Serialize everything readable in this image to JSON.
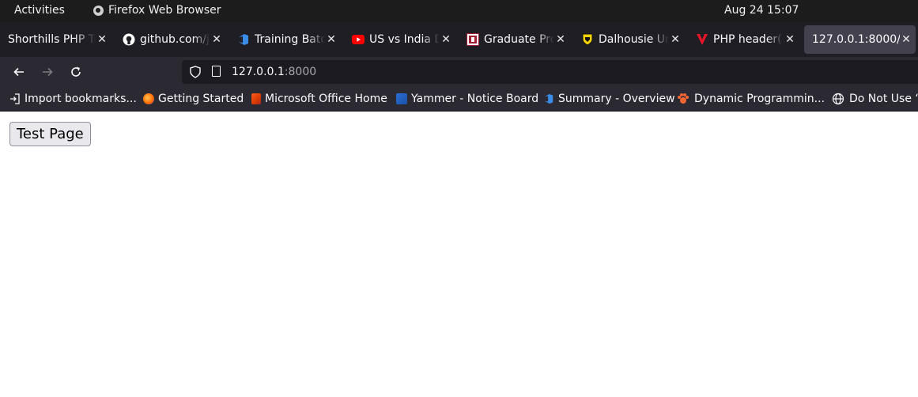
{
  "system_bar": {
    "activities": "Activities",
    "app_name": "Firefox Web Browser",
    "clock": "Aug 24  15:07"
  },
  "tabs": [
    {
      "title": "Shorthills PHP Tr",
      "icon": "shorthills-favicon-icon",
      "active": false
    },
    {
      "title": "github.com/j",
      "icon": "github-icon",
      "active": false
    },
    {
      "title": "Training Batc",
      "icon": "azure-devops-icon",
      "active": false
    },
    {
      "title": "US vs India Da",
      "icon": "youtube-icon",
      "active": false
    },
    {
      "title": "Graduate Pro",
      "icon": "university-crest-icon",
      "active": false
    },
    {
      "title": "Dalhousie Un",
      "icon": "dalhousie-shield-icon",
      "active": false
    },
    {
      "title": "PHP header()",
      "icon": "php-v-icon",
      "active": false
    },
    {
      "title": "127.0.0.1:8000/",
      "icon": "",
      "active": true
    }
  ],
  "navigation": {
    "url_host": "127.0.0.1",
    "url_port": ":8000"
  },
  "bookmarks": [
    {
      "label": "Import bookmarks...",
      "icon": "import-icon"
    },
    {
      "label": "Getting Started",
      "icon": "firefox-icon"
    },
    {
      "label": "Microsoft Office Home",
      "icon": "office-icon"
    },
    {
      "label": "Yammer - Notice Board",
      "icon": "yammer-icon"
    },
    {
      "label": "Summary - Overview",
      "icon": "azure-devops-icon"
    },
    {
      "label": "Dynamic Programmin...",
      "icon": "paw-icon"
    },
    {
      "label": "Do Not Use “",
      "icon": "globe-icon"
    }
  ],
  "page": {
    "button_label": "Test Page"
  },
  "colors": {
    "tab_strip": "#1f1e25",
    "toolbar": "#2b2a33",
    "active_tab": "#42414d",
    "url_field": "#1c1b22"
  }
}
